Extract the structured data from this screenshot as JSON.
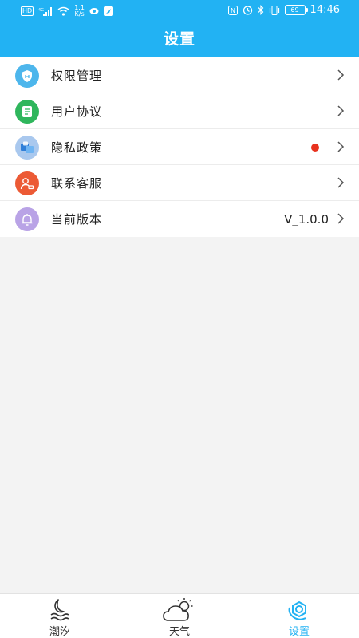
{
  "status_bar": {
    "network_badge": "HD",
    "speed_value": "1.1",
    "speed_unit": "K/s",
    "battery": "69",
    "time": "14:46"
  },
  "header": {
    "title": "设置"
  },
  "menu": {
    "items": [
      {
        "label": "权限管理",
        "icon": "shield-icon",
        "color": "#4db6ec"
      },
      {
        "label": "用户协议",
        "icon": "document-icon",
        "color": "#2fb65c"
      },
      {
        "label": "隐私政策",
        "icon": "privacy-icon",
        "color": "#7ba9e6",
        "has_red_dot": true
      },
      {
        "label": "联系客服",
        "icon": "customer-service-icon",
        "color": "#ec5a35"
      },
      {
        "label": "当前版本",
        "icon": "bell-icon",
        "color": "#b9a3e6",
        "value": "V_1.0.0"
      }
    ]
  },
  "tabbar": {
    "tabs": [
      {
        "label": "潮汐",
        "icon": "tide-icon",
        "active": false
      },
      {
        "label": "天气",
        "icon": "weather-cloud-icon",
        "active": false
      },
      {
        "label": "设置",
        "icon": "settings-icon",
        "active": true
      }
    ],
    "active_color": "#22b2f3"
  }
}
